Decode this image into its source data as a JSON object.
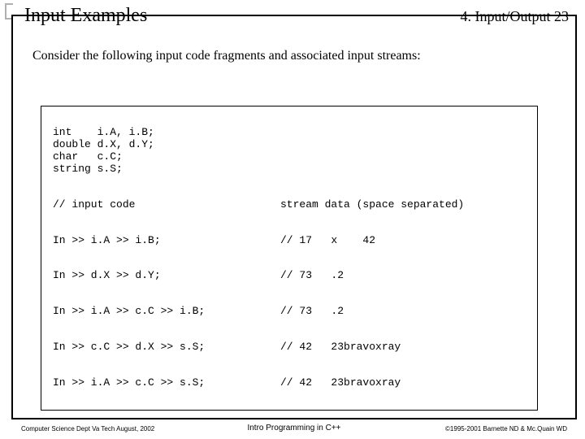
{
  "header": {
    "title": "Input Examples",
    "chapter": "4. Input/Output  23"
  },
  "intro": "Consider the following input code fragments and associated input streams:",
  "code": {
    "decl": "int    i.A, i.B;\ndouble d.X, d.Y;\nchar   c.C;\nstring s.S;",
    "hdr_left": "// input code",
    "hdr_right": "stream data (space separated)",
    "rows": [
      {
        "left": "In >> i.A >> i.B;",
        "right": "// 17   x    42"
      },
      {
        "left": "In >> d.X >> d.Y;",
        "right": "// 73   .2"
      },
      {
        "left": "In >> i.A >> c.C >> i.B;",
        "right": "// 73   .2"
      },
      {
        "left": "In >> c.C >> d.X >> s.S;",
        "right": "// 42   23bravoxray"
      },
      {
        "left": "In >> i.A >> c.C >> s.S;",
        "right": "// 42   23bravoxray"
      }
    ]
  },
  "footer": {
    "left": "Computer Science Dept Va Tech  August, 2002",
    "center": "Intro Programming in C++",
    "right": "©1995-2001  Barnette ND & Mc.Quain WD"
  }
}
